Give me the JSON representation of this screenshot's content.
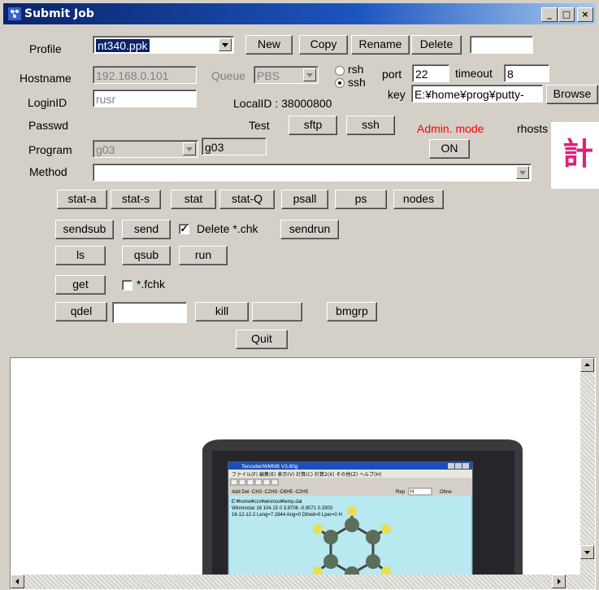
{
  "window": {
    "title": "Submit Job",
    "minimize": "_",
    "maximize": "□",
    "close": "×"
  },
  "profile": {
    "label": "Profile",
    "value": "nt340.ppk",
    "new": "New",
    "copy": "Copy",
    "rename": "Rename",
    "delete": "Delete",
    "extra_value": ""
  },
  "host": {
    "hostname_label": "Hostname",
    "hostname_value": "192.168.0.101",
    "queue_label": "Queue",
    "queue_value": "PBS",
    "rsh": "rsh",
    "ssh": "ssh",
    "protocol_selected": "ssh",
    "port_label": "port",
    "port_value": "22",
    "timeout_label": "timeout",
    "timeout_value": "8",
    "key_label": "key",
    "key_value": "E:¥home¥prog¥putty-",
    "browse": "Browse"
  },
  "login": {
    "label": "LoginID",
    "value": "rusr",
    "localid": "LocalID : 38000800"
  },
  "passwd": {
    "label": "Passwd",
    "test_label": "Test",
    "sftp": "sftp",
    "ssh": "ssh",
    "admin_mode": "Admin. mode",
    "admin_on": "ON",
    "rhosts": "rhosts",
    "side_kanji": "計"
  },
  "program": {
    "label": "Program",
    "value": "g03",
    "readout": "g03"
  },
  "method": {
    "label": "Method",
    "value": ""
  },
  "actions": {
    "stat_a": "stat-a",
    "stat_s": "stat-s",
    "stat": "stat",
    "stat_q": "stat-Q",
    "psall": "psall",
    "ps": "ps",
    "nodes": "nodes",
    "sendsub": "sendsub",
    "send": "send",
    "delete_chk_label": "Delete *.chk",
    "sendrun": "sendrun",
    "ls": "ls",
    "qsub": "qsub",
    "run": "run",
    "get": "get",
    "fchk_label": "*.fchk",
    "qdel": "qdel",
    "qdel_value": "",
    "kill": "kill",
    "blank_button": "",
    "bmgrp": "bmgrp",
    "quit": "Quit"
  },
  "preview": {
    "app_title": "Tencube/WMNB V3.80g",
    "menus": [
      "ファイル(F)",
      "編集(E)",
      "表示(V)",
      "計算(C)",
      "計算2(X)",
      "その他(Z)",
      "ヘルプ(H)"
    ],
    "toolbar": [
      "Add",
      "Del",
      "-CH3",
      "-C2H3",
      "-C6H5",
      "-C2H5"
    ],
    "rep_label": "Rep",
    "element": "H",
    "ohne": "Ohne",
    "path": "E:¥home¥ccs¥winmos¥temp.dat",
    "line1": "Winmostar 16 104.15 0 3.8706 -0.9071 0.3303",
    "line2": "16-12-12-2 Leng=7.2844 Ang=0 Dihed=0 Lper=0 H",
    "colors": {
      "screen": "#b8e8f0",
      "carbon": "#5a6e5a",
      "hydrogen": "#e8e050"
    }
  }
}
